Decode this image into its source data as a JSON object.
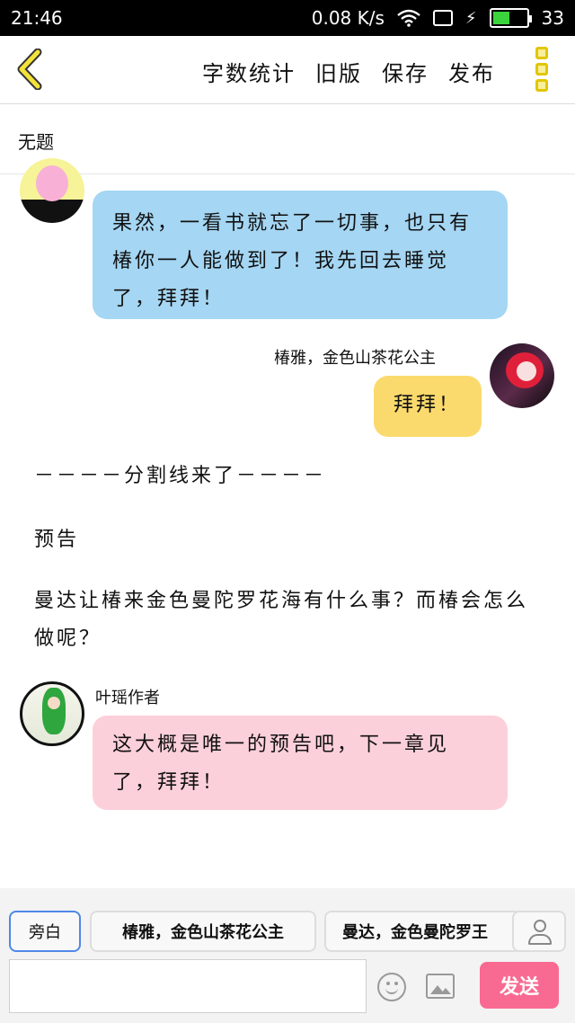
{
  "status_bar": {
    "time": "21:46",
    "speed": "0.08 K/s",
    "battery": "33"
  },
  "toolbar": {
    "word_count": "字数统计",
    "old_version": "旧版",
    "save": "保存",
    "publish": "发布"
  },
  "doc_title": "无题",
  "messages": {
    "first_bubble": "果然，一看书就忘了一切事，也只有椿你一人能做到了！我先回去睡觉了，拜拜！",
    "second_name": "椿雅，金色山茶花公主",
    "second_bubble": "拜拜！",
    "separator": "－－－－分割线来了－－－－",
    "preview_label": "预告",
    "preview_text": "曼达让椿来金色曼陀罗花海有什么事？而椿会怎么做呢？",
    "third_name": "叶瑶作者",
    "third_bubble": "这大概是唯一的预告吧，下一章见了，拜拜！"
  },
  "bottom": {
    "role_aside": "旁白",
    "role_a": "椿雅，金色山茶花公主",
    "role_b": "曼达，金色曼陀罗王",
    "input_value": "",
    "send": "发送"
  },
  "colors": {
    "blue_bubble": "#a5d6f3",
    "yellow_bubble": "#fbda6d",
    "pink_bubble": "#fcd0da",
    "send_button": "#f96a92",
    "back_icon": "#e2c600"
  }
}
